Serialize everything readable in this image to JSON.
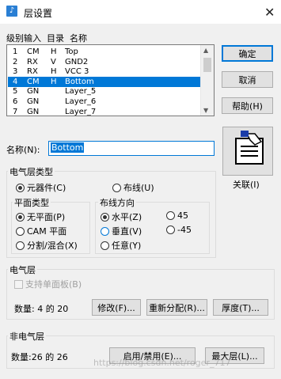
{
  "window": {
    "title": "层设置",
    "close_glyph": "✕"
  },
  "list": {
    "header": "级别输入  目录  名称",
    "rows": [
      {
        "level": "1",
        "kind": "CM",
        "dir": "H",
        "name": "Top"
      },
      {
        "level": "2",
        "kind": "RX",
        "dir": "V",
        "name": "GND2"
      },
      {
        "level": "3",
        "kind": "RX",
        "dir": "H",
        "name": "VCC 3"
      },
      {
        "level": "4",
        "kind": "CM",
        "dir": "H",
        "name": "Bottom"
      },
      {
        "level": "5",
        "kind": "GN",
        "dir": "",
        "name": "Layer_5"
      },
      {
        "level": "6",
        "kind": "GN",
        "dir": "",
        "name": "Layer_6"
      },
      {
        "level": "7",
        "kind": "GN",
        "dir": "",
        "name": "Layer_7"
      }
    ],
    "selected_index": 3
  },
  "buttons": {
    "ok": "确定",
    "cancel": "取消",
    "help": "帮助(H)",
    "associate": "关联(I)",
    "modify": "修改(F)...",
    "reassign": "重新分配(R)...",
    "thickness": "厚度(T)...",
    "enable_disable": "启用/禁用(E)...",
    "max_layers": "最大层(L)..."
  },
  "name_field": {
    "label": "名称(N):",
    "value": "Bottom"
  },
  "electrical_layer_type": {
    "title": "电气层类型",
    "component": "元器件(C)",
    "routing": "布线(U)"
  },
  "plane_type": {
    "title": "平面类型",
    "no_plane": "无平面(P)",
    "cam_plane": "CAM 平面",
    "split_mixed": "分割/混合(X)"
  },
  "routing_direction": {
    "title": "布线方向",
    "horizontal": "水平(Z)",
    "vertical": "垂直(V)",
    "any": "任意(Y)",
    "deg45": "45",
    "degm45": "-45"
  },
  "electrical": {
    "title": "电气层",
    "single_sided": "支持单面板(B)",
    "count": "数量: 4 的 20"
  },
  "non_electrical": {
    "title": "非电气层",
    "count": "数量:26 的 26"
  },
  "watermark": "https://blog.csdn.net/roger_717"
}
